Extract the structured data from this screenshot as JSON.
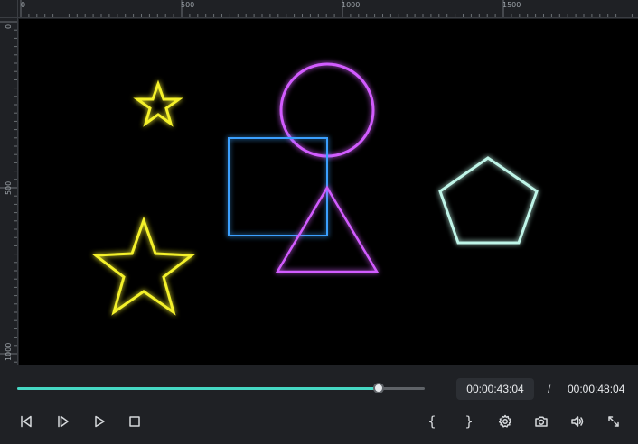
{
  "ruler": {
    "top_labels": [
      "0",
      "500",
      "1000",
      "1500"
    ],
    "left_labels": [
      "0",
      "500",
      "1000"
    ]
  },
  "canvas": {
    "shapes": [
      {
        "name": "small-star-shape",
        "kind": "star",
        "color": "#f4f12a"
      },
      {
        "name": "large-star-shape",
        "kind": "star",
        "color": "#f4f12a"
      },
      {
        "name": "circle-shape",
        "kind": "circle",
        "color": "#d25cff"
      },
      {
        "name": "square-shape",
        "kind": "rect",
        "color": "#3aa0ff"
      },
      {
        "name": "triangle-shape",
        "kind": "triangle",
        "color": "#d25cff"
      },
      {
        "name": "pentagon-shape",
        "kind": "pentagon",
        "color": "#bff5e8"
      }
    ]
  },
  "player": {
    "progress_fraction": 0.886,
    "progress_color": "#46d8c4",
    "current_time": "00:00:43:04",
    "separator": "/",
    "total_time": "00:00:48:04",
    "controls": {
      "prev_frame_icon": "step-back-icon",
      "next_frame_icon": "step-forward-icon",
      "play_icon": "play-icon",
      "stop_icon": "stop-icon",
      "mark_in_label": "{",
      "mark_out_label": "}",
      "settings_icon": "gear-icon",
      "snapshot_icon": "camera-icon",
      "volume_icon": "volume-icon",
      "fullscreen_icon": "fullscreen-icon"
    }
  }
}
